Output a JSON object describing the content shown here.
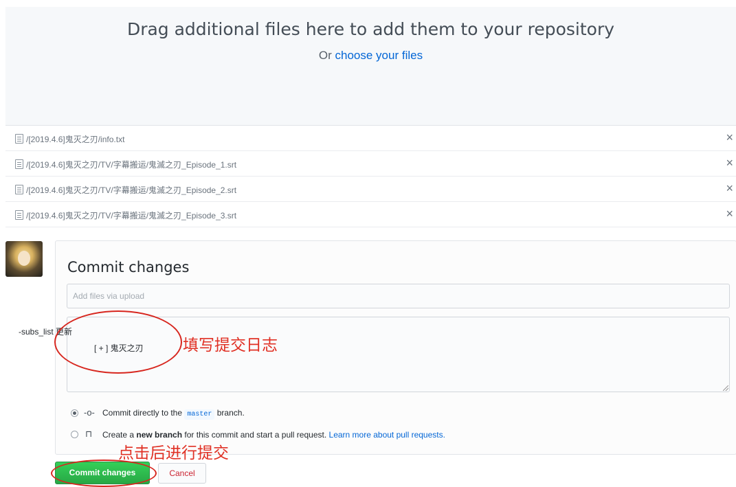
{
  "upload": {
    "title": "Drag additional files here to add them to your repository",
    "subtitle_prefix": "Or ",
    "subtitle_link": "choose your files"
  },
  "files": [
    {
      "path": "/[2019.4.6]鬼灭之刃/info.txt",
      "remove_glyph": "×"
    },
    {
      "path": "/[2019.4.6]鬼灭之刃/TV/字幕搬运/鬼滅之刃_Episode_1.srt",
      "remove_glyph": "×"
    },
    {
      "path": "/[2019.4.6]鬼灭之刃/TV/字幕搬运/鬼滅之刃_Episode_2.srt",
      "remove_glyph": "×"
    },
    {
      "path": "/[2019.4.6]鬼灭之刃/TV/字幕搬运/鬼滅之刃_Episode_3.srt",
      "remove_glyph": "×"
    }
  ],
  "commit": {
    "title": "Commit changes",
    "summary_placeholder": "Add files via upload",
    "description_line1": "-subs_list 更新",
    "description_line2": "[ + ] 鬼灭之刃",
    "option_direct": {
      "prefix": "Commit directly to the",
      "branch": "master",
      "suffix": "branch.",
      "icon": "commit-icon",
      "icon_glyph": "-o-"
    },
    "option_new_branch": {
      "text_before": "Create a",
      "bold": "new branch",
      "text_after": "for this commit and start a pull request.",
      "link": "Learn more about pull requests.",
      "icon": "pull-request-icon",
      "icon_glyph": "⊓"
    },
    "commit_button": "Commit changes",
    "cancel_button": "Cancel"
  },
  "annotations": {
    "fill_log": "填写提交日志",
    "click_commit": "点击后进行提交"
  },
  "colors": {
    "accent_link": "#0366d6",
    "commit_green": "#28a745",
    "cancel_red": "#cb2431",
    "annotation_red": "#e03024"
  }
}
